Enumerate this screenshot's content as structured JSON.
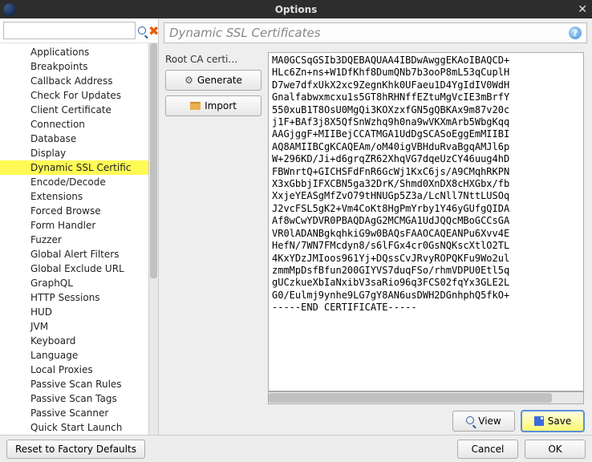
{
  "window": {
    "title": "Options"
  },
  "search": {
    "placeholder": ""
  },
  "tree": {
    "selected_index": 10,
    "items": [
      "Applications",
      "Breakpoints",
      "Callback Address",
      "Check For Updates",
      "Client Certificate",
      "Connection",
      "Database",
      "Display",
      "Dynamic SSL Certific",
      "Encode/Decode",
      "Extensions",
      "Forced Browse",
      "Form Handler",
      "Fuzzer",
      "Global Alert Filters",
      "Global Exclude URL",
      "GraphQL",
      "HTTP Sessions",
      "HUD",
      "JVM",
      "Keyboard",
      "Language",
      "Local Proxies",
      "Passive Scan Rules",
      "Passive Scan Tags",
      "Passive Scanner",
      "Quick Start Launch"
    ]
  },
  "panel": {
    "title": "Dynamic SSL Certificates",
    "root_label": "Root CA certi…",
    "generate": "Generate",
    "import": "Import",
    "view": "View",
    "save": "Save",
    "certificate": "MA0GCSqGSIb3DQEBAQUAA4IBDwAwggEKAoIBAQCD+\nHLc6Zn+ns+W1DfKhf8DumQNb7b3ooP8mL53qCuplH\nD7we7dfxUkX2xc9ZegnKhk0UFaeu1D4YgIdIV0WdH\nGnalfabwxmcxu1s5GT8hRHNffEZtuMgVcIE3mBrfY\n550xuB1T8OsU0MgQi3KOXzxfGN5gQBKAx9m87v20c\nj1F+BAf3j8X5QfSnWzhq9h0na9wVKXmArb5WbgKqq\nAAGjggF+MIIBejCCATMGA1UdDgSCASoEggEmMIIBI\nAQ8AMIIBCgKCAQEAm/oM40igVBHduRvaBgqAMJl6p\nW+296KD/Ji+d6grqZR62XhqVG7dqeUzCY46uug4hD\nFBWnrtQ+GICHSFdFnR6GcWj1KxC6js/A9CMqhRKPN\nX3xGbbjIFXCBN5ga32DrK/Shmd0XnDX8cHXGbx/fb\nXxjeYEASgMfZvO79tHNUGp5Z3a/LcNll7NttLUSOq\nJ2vcFSL5gK2+Vm4CoKt8HgPmYrby1Y46yGUfgQIDA\nAf8wCwYDVR0PBAQDAgG2MCMGA1UdJQQcMBoGCCsGA\nVR0lADANBgkqhkiG9w0BAQsFAAOCAQEANPu6Xvv4E\nHefN/7WN7FMcdyn8/s6lFGx4cr0GsNQKscXtlO2TL\n4KxYDzJMIoos961Yj+DQssCvJRvyROPQKFu9Wo2ul\nzmmMpDsfBfun200GIYVS7duqFSo/rhmVDPU0Etl5q\ngUCzkueXbIaNxibV3saRio96q3FCS02fqYx3GLE2L\nG0/Eulmj9ynhe9LG7gY8AN6usDWH2DGnhphQ5fkO+\n-----END CERTIFICATE-----"
  },
  "footer": {
    "reset": "Reset to Factory Defaults",
    "cancel": "Cancel",
    "ok": "OK"
  }
}
